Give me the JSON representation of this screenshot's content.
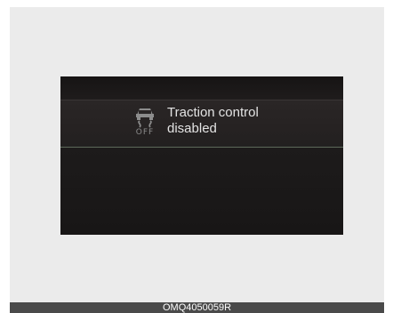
{
  "display": {
    "message_line_1": "Traction control",
    "message_line_2": "disabled",
    "icon": "traction-control-off-icon",
    "icon_sub_label": "OFF"
  },
  "footer": {
    "code": "OMQ4050059R"
  },
  "colors": {
    "screen_background": "#1e1c1c",
    "message_text": "#e3e3e3",
    "icon_color": "#8c8c8c",
    "divider_accent": "#5d6a5a",
    "footer_bar": "#4a4a4a",
    "frame_background": "#ebebeb"
  }
}
